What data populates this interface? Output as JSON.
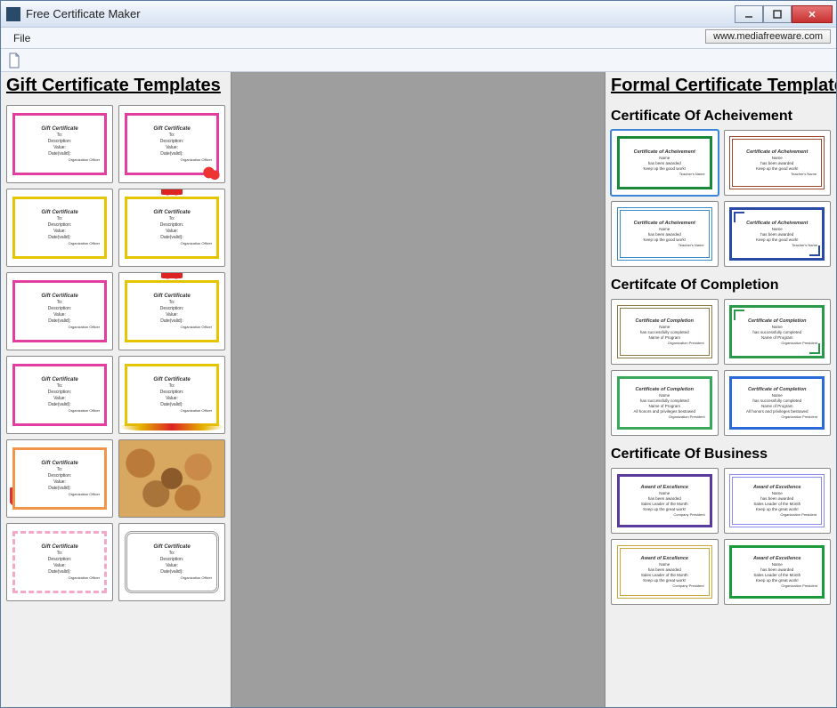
{
  "window": {
    "title": "Free Certificate Maker",
    "link_button": "www.mediafreeware.com"
  },
  "menu": {
    "file": "File"
  },
  "left": {
    "title": "Gift Certificate Templates",
    "cert": {
      "heading": "Gift Certificate",
      "to": "To:",
      "desc": "Description:",
      "value": "Value:",
      "date": "Date(valid):",
      "sig": "Organization Officer"
    }
  },
  "right": {
    "title": "Formal Certificate Templates",
    "sec1": "Certificate Of Acheivement",
    "sec2": "Certifcate Of Completion",
    "sec3": "Certificate Of Business",
    "cert_ach": {
      "heading": "Certificate of Acheivement",
      "name": "Name",
      "l1": "has been awarded",
      "l2": "Keep up the good work!",
      "sig": "Teacher's Name"
    },
    "cert_comp": {
      "heading": "Certificate of Completion",
      "name": "Name",
      "l1": "has successfully completed",
      "l2": "Name of Program",
      "l3": "All honors and privileges bestowed",
      "sig": "Organization President"
    },
    "cert_biz": {
      "heading": "Award of Excellence",
      "name": "Name",
      "l1": "has been awarded",
      "l2": "Sales Leader of the Month",
      "l3": "Keep up the great work!",
      "sig1": "Company President",
      "sig2": "Organization President"
    }
  }
}
